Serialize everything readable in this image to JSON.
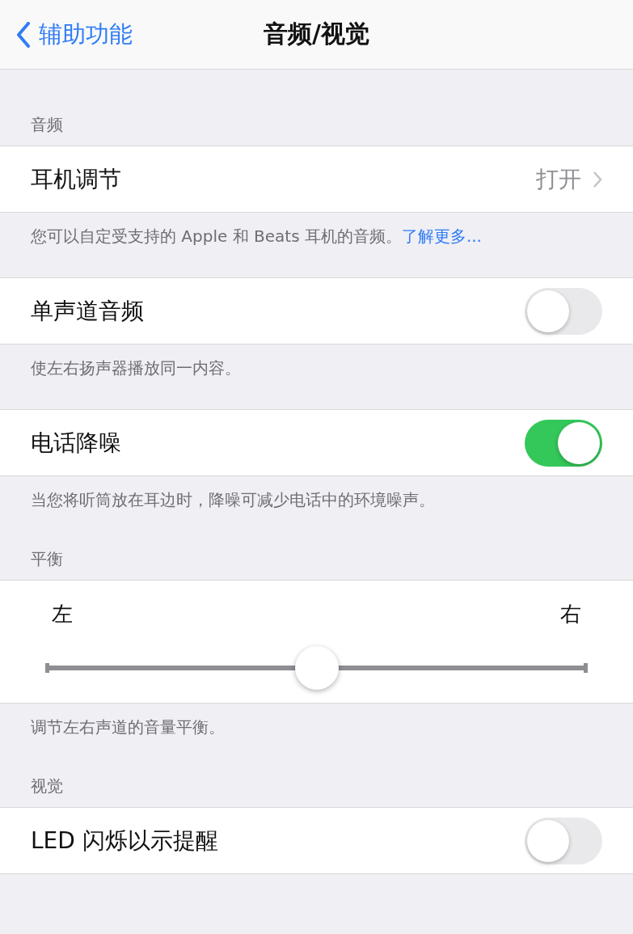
{
  "nav": {
    "back": "辅助功能",
    "title": "音频/视觉"
  },
  "sections": [
    {
      "header": "音频",
      "rows": [
        {
          "kind": "link",
          "label": "耳机调节",
          "value": "打开"
        }
      ],
      "footer": "您可以自定受支持的 Apple 和 Beats 耳机的音频。",
      "footer_link": "了解更多..."
    },
    {
      "rows": [
        {
          "kind": "toggle",
          "label": "单声道音频",
          "on": false
        }
      ],
      "footer": "使左右扬声器播放同一内容。"
    },
    {
      "rows": [
        {
          "kind": "toggle",
          "label": "电话降噪",
          "on": true
        }
      ],
      "footer": "当您将听筒放在耳边时，降噪可减少电话中的环境噪声。"
    },
    {
      "header": "平衡",
      "rows": [
        {
          "kind": "slider",
          "left": "左",
          "right": "右",
          "level": 0.5
        }
      ],
      "footer": "调节左右声道的音量平衡。"
    },
    {
      "header": "视觉",
      "rows": [
        {
          "kind": "toggle",
          "label": "LED 闪烁以示提醒",
          "on": false
        }
      ]
    }
  ]
}
